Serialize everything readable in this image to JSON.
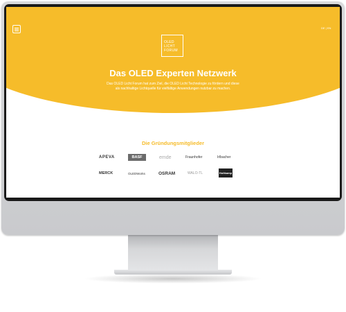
{
  "browser": {
    "url": "oledlichtforum.de"
  },
  "header": {
    "language": "DE | EN"
  },
  "logo": {
    "lines": [
      "OLED",
      "LICHT",
      "FORUM"
    ]
  },
  "hero": {
    "title": "Das OLED Experten Netzwerk",
    "subtitle": "Das OLED Licht Forum hat zum Ziel, die OLED Licht Technologie zu fördern und diese als nachhaltige Lichtquelle für vielfältige Anwendungen nutzbar zu machen."
  },
  "members": {
    "heading": "Die Gründungsmitglieder",
    "logos": [
      "APEVA",
      "BASF",
      "emde",
      "Fraunhofer",
      "Irlbacher",
      "MERCK",
      "OLEDWorks",
      "OSRAM",
      "WALO-TL",
      "Holtkamp"
    ]
  },
  "colors": {
    "accent": "#f6bc2a",
    "text_on_accent": "#ffffff"
  }
}
